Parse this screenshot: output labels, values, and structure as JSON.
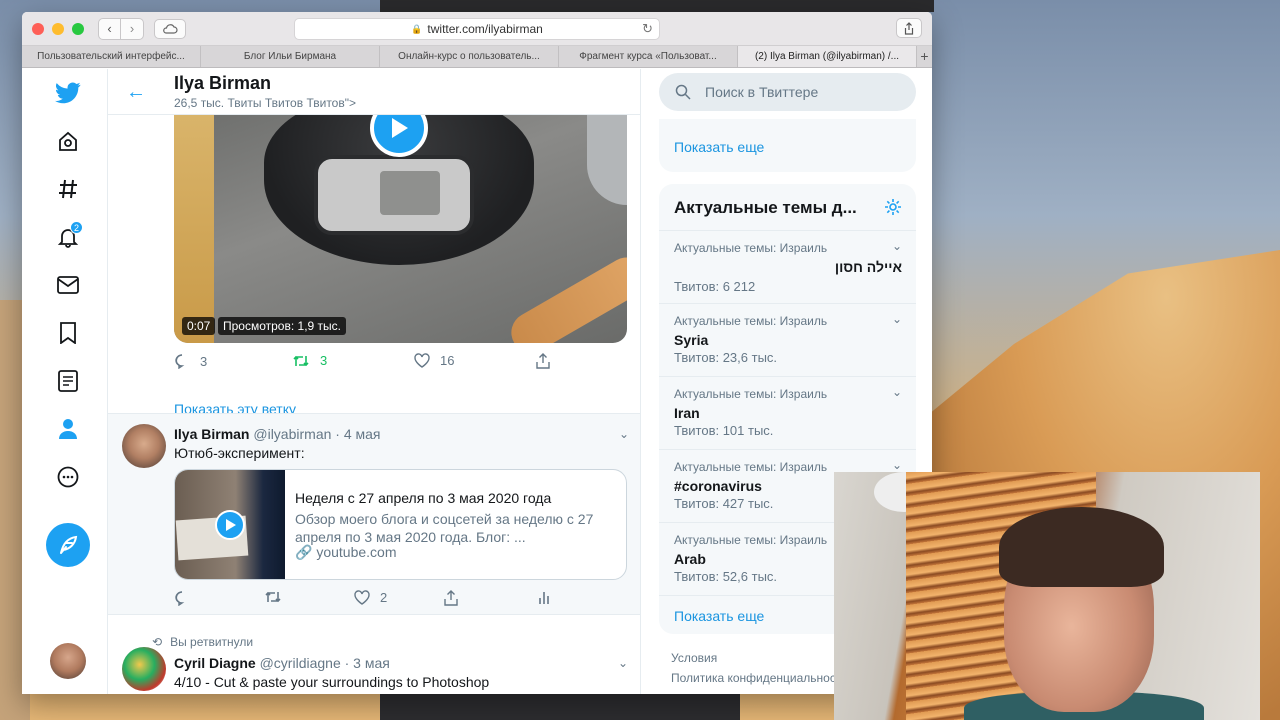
{
  "browser": {
    "url": "twitter.com/ilyabirman",
    "tabs": [
      {
        "label": "Пользовательский интерфейс...",
        "active": false
      },
      {
        "label": "Блог Ильи Бирмана",
        "active": false
      },
      {
        "label": "Онлайн-курс о пользователь...",
        "active": false
      },
      {
        "label": "Фрагмент курса «Пользоват...",
        "active": false
      },
      {
        "label": "(2) Ilya Birman (@ilyabirman) /...",
        "active": true
      }
    ],
    "add_tab": "+"
  },
  "nav": {
    "icons": [
      "twitter-logo-icon",
      "home-icon",
      "hashtag-icon",
      "bell-icon",
      "mail-icon",
      "bookmark-icon",
      "list-icon",
      "profile-icon",
      "more-icon"
    ],
    "notification_badge": "2",
    "accent": "#1da1f2"
  },
  "header": {
    "title": "Ilya Birman",
    "subtitle": "26,5 тыс. Твиты Твитов Твитов\">"
  },
  "tweet1": {
    "video_time": "0:07",
    "video_views": "Просмотров: 1,9 тыс.",
    "replies": "3",
    "retweets": "3",
    "likes": "16",
    "show_thread": "Показать эту ветку"
  },
  "tweet2": {
    "name": "Ilya Birman",
    "handle": "@ilyabirman · 4 мая",
    "text": "Ютюб-эксперимент:",
    "card_title": "Неделя с 27 апреля по 3 мая 2020 года",
    "card_desc": "Обзор моего блога и соцсетей за неделю с 27 апреля по 3 мая 2020 года. Блог: ...",
    "card_url": "youtube.com",
    "likes": "2"
  },
  "tweet3": {
    "retweeted": "Вы ретвитнули",
    "name": "Cyril Diagne",
    "handle": "@cyrildiagne · 3 мая",
    "text": "4/10 - Cut & paste your surroundings to Photoshop"
  },
  "sidebar": {
    "search_placeholder": "Поиск в Твиттере",
    "show_more_1": "Показать еще",
    "trends_title": "Актуальные темы д...",
    "trends": [
      {
        "context": "Актуальные темы: Израиль",
        "name": "איילה חסון",
        "count": "Твитов: 6 212"
      },
      {
        "context": "Актуальные темы: Израиль",
        "name": "Syria",
        "count": "Твитов: 23,6 тыс."
      },
      {
        "context": "Актуальные темы: Израиль",
        "name": "Iran",
        "count": "Твитов: 101 тыс."
      },
      {
        "context": "Актуальные темы: Израиль",
        "name": "#coronavirus",
        "count": "Твитов: 427 тыс."
      },
      {
        "context": "Актуальные темы: Израиль",
        "name": "Arab",
        "count": "Твитов: 52,6 тыс."
      }
    ],
    "show_more_2": "Показать еще",
    "footer_terms": "Условия",
    "footer_privacy": "Политика конфиденциальности"
  }
}
